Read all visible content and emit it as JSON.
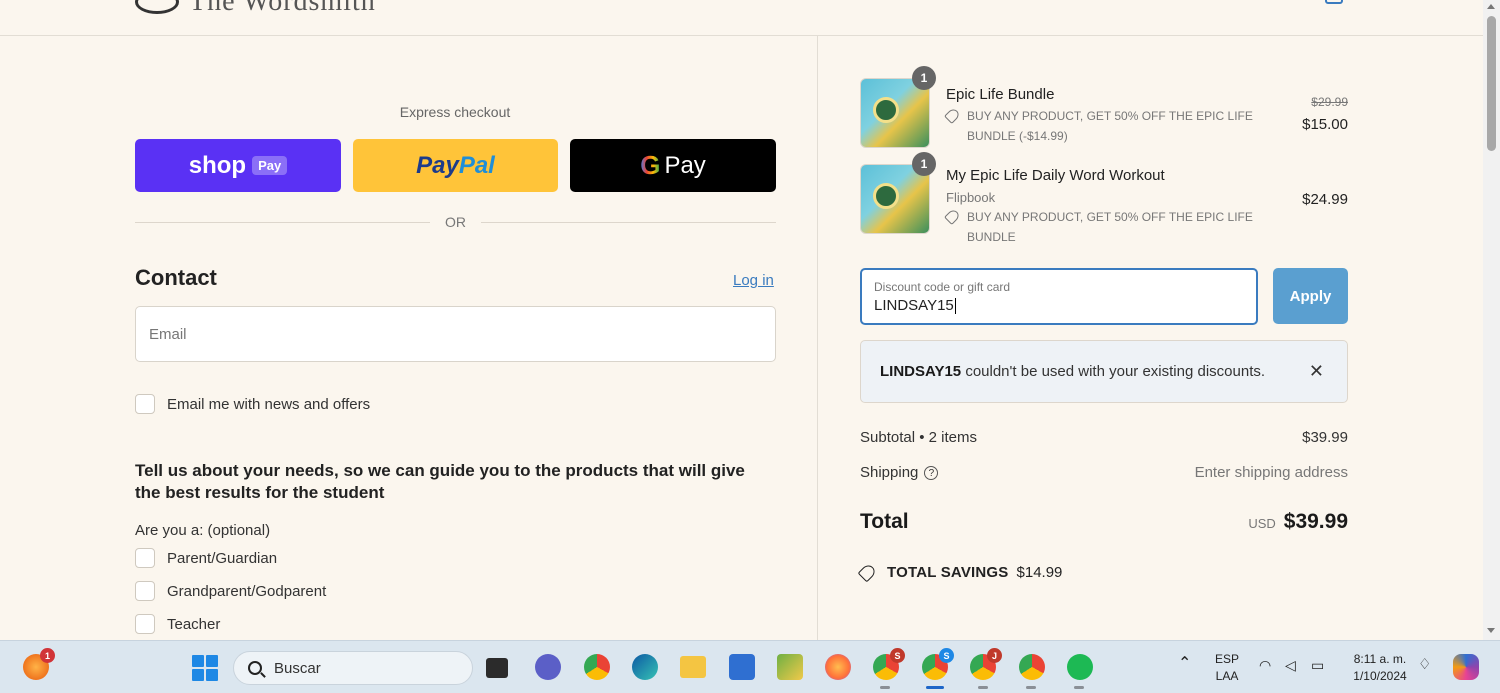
{
  "header": {
    "brand_name": "The Wordsmith"
  },
  "express": {
    "title": "Express checkout",
    "shoppay_label": "shop",
    "shoppay_tag": "Pay",
    "paypal_pay": "Pay",
    "paypal_pal": "Pal",
    "gpay_g": "G",
    "gpay_label": "Pay",
    "or_label": "OR"
  },
  "contact": {
    "title": "Contact",
    "login_label": "Log in",
    "email_placeholder": "Email",
    "newsletter_label": "Email me with news and offers"
  },
  "survey": {
    "prompt": "Tell us about your needs, so we can guide you to the products that will give the best results for the student",
    "question": "Are you a: (optional)",
    "options": [
      "Parent/Guardian",
      "Grandparent/Godparent",
      "Teacher"
    ]
  },
  "cart": {
    "items": [
      {
        "qty": "1",
        "name": "Epic Life Bundle",
        "variant": "",
        "discount": "BUY ANY PRODUCT, GET 50% OFF THE EPIC LIFE BUNDLE (-$14.99)",
        "old_price": "$29.99",
        "price": "$15.00"
      },
      {
        "qty": "1",
        "name": "My Epic Life Daily Word Workout",
        "variant": "Flipbook",
        "discount": "BUY ANY PRODUCT, GET 50% OFF THE EPIC LIFE BUNDLE",
        "old_price": "",
        "price": "$24.99"
      }
    ],
    "discount_field": {
      "label": "Discount code or gift card",
      "value": "LINDSAY15"
    },
    "apply_label": "Apply",
    "alert": {
      "code": "LINDSAY15",
      "message": " couldn't be used with your existing discounts."
    },
    "subtotal_label": "Subtotal • 2 items",
    "subtotal_value": "$39.99",
    "shipping_label": "Shipping",
    "shipping_value": "Enter shipping address",
    "total_label": "Total",
    "total_currency": "USD",
    "total_value": "$39.99",
    "savings_label": "TOTAL SAVINGS",
    "savings_value": "$14.99"
  },
  "taskbar": {
    "search_placeholder": "Buscar",
    "notification_badge": "1",
    "lang_top": "ESP",
    "lang_bottom": "LAA",
    "time": "8:11 a. m.",
    "date": "1/10/2024",
    "chrome_badges": [
      "S",
      "S",
      "J"
    ]
  },
  "colors": {
    "shoppay": "#5a31f4",
    "paypal": "#ffc439",
    "gpay": "#000000",
    "accent": "#3a7bbf",
    "apply": "#5a9fd0",
    "page_bg": "#fbf6ee"
  }
}
